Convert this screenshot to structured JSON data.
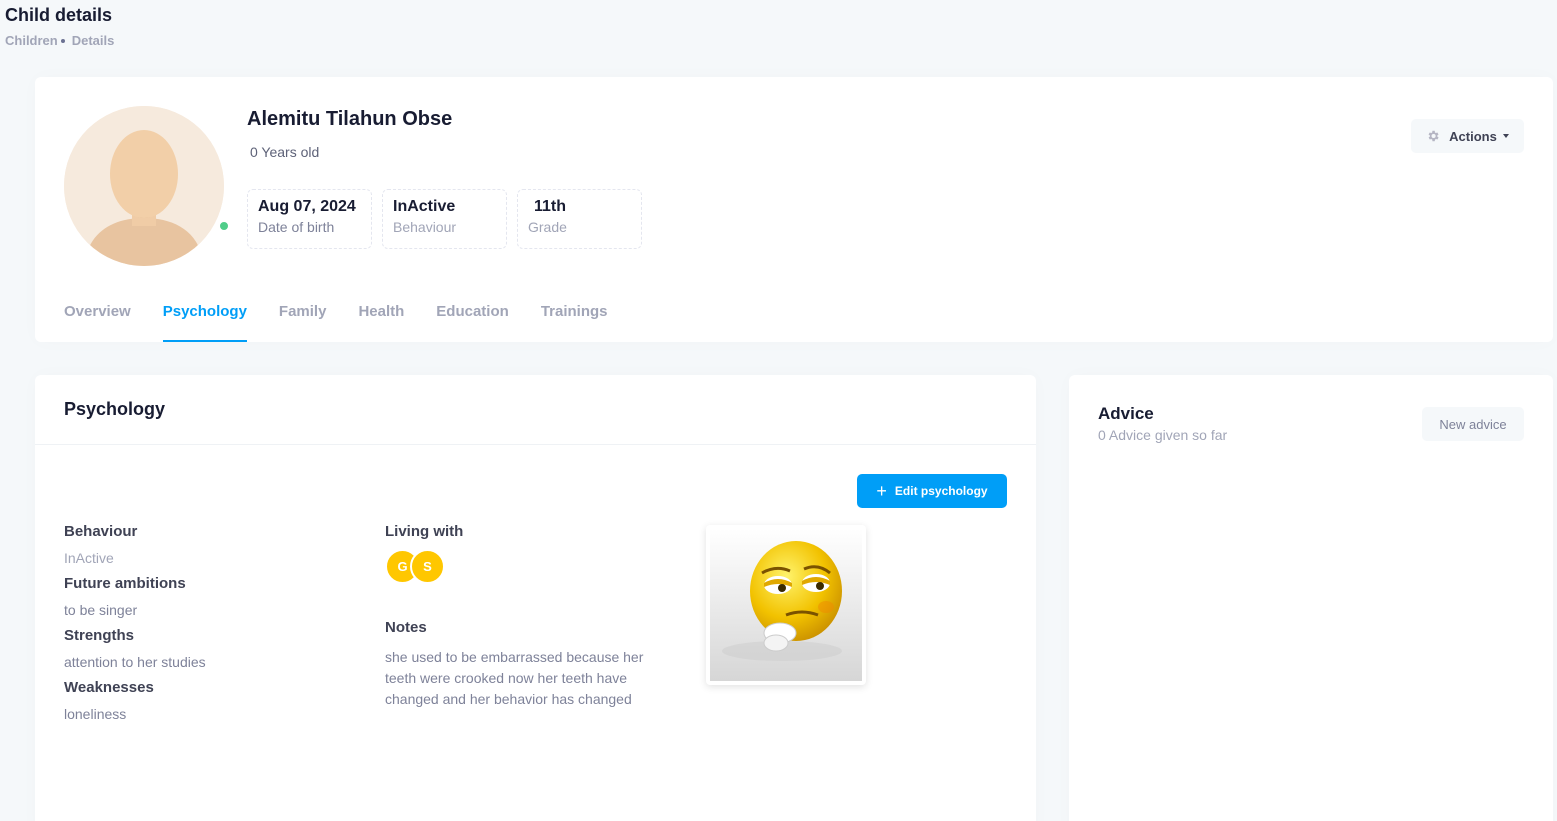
{
  "page": {
    "title": "Child details",
    "breadcrumb": [
      "Children",
      "Details"
    ]
  },
  "profile": {
    "name": "Alemitu Tilahun Obse",
    "age": "0 Years old",
    "online_color": "#50cd89",
    "stats": [
      {
        "value": "Aug 07, 2024",
        "label": "Date of birth"
      },
      {
        "value": "InActive",
        "label": "Behaviour"
      },
      {
        "value": "11th",
        "label": "Grade"
      }
    ],
    "actions_label": "Actions",
    "actions_icon": "gear-icon"
  },
  "tabs": [
    {
      "label": "Overview",
      "active": false
    },
    {
      "label": "Psychology",
      "active": true
    },
    {
      "label": "Family",
      "active": false
    },
    {
      "label": "Health",
      "active": false
    },
    {
      "label": "Education",
      "active": false
    },
    {
      "label": "Trainings",
      "active": false
    }
  ],
  "psychology": {
    "title": "Psychology",
    "edit_label": "Edit psychology",
    "fields": [
      {
        "label": "Behaviour",
        "value": "InActive"
      },
      {
        "label": "Future ambitions",
        "value": "to be singer"
      },
      {
        "label": "Strengths",
        "value": "attention to her studies"
      },
      {
        "label": "Weaknesses",
        "value": "loneliness"
      }
    ],
    "living_with_label": "Living with",
    "living_with": [
      "G",
      "S"
    ],
    "notes_label": "Notes",
    "notes": "she used to be embarrassed because her teeth were crooked now her teeth have changed and her behavior has changed"
  },
  "advice": {
    "title": "Advice",
    "subtitle": "0 Advice given so far",
    "new_label": "New advice"
  },
  "colors": {
    "primary": "#009ef7",
    "warning": "#ffc700",
    "muted": "#a1a5b7"
  }
}
